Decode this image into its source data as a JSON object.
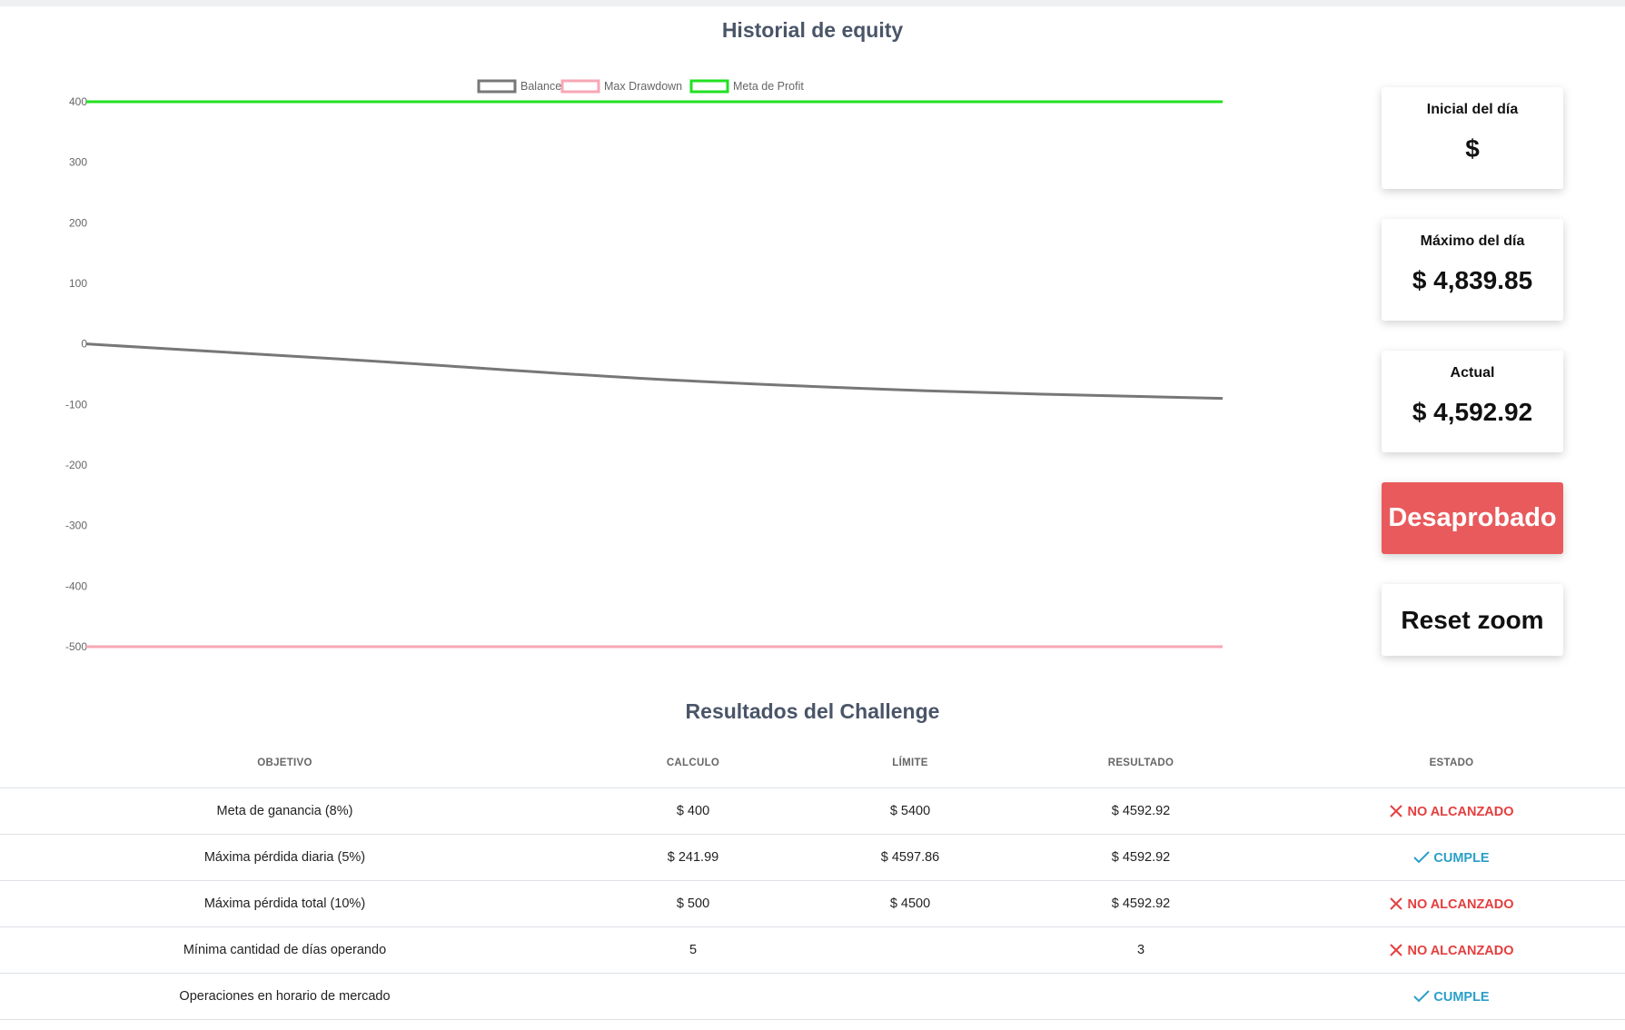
{
  "chart_title": "Historial de equity",
  "chart_data": {
    "type": "line",
    "legend": [
      "Balance",
      "Max Drawdown",
      "Meta de Profit"
    ],
    "legend_position": "top",
    "grid": false,
    "ylim": [
      -500,
      400
    ],
    "y_ticks": [
      "400",
      "300",
      "200",
      "100",
      "0",
      "-100",
      "-200",
      "-300",
      "-400",
      "-500"
    ],
    "series": [
      {
        "name": "Balance",
        "color": "#777777",
        "x": [
          0,
          1,
          2,
          3,
          4
        ],
        "values": [
          0,
          -28,
          -58,
          -78,
          -90
        ]
      },
      {
        "name": "Max Drawdown",
        "color": "#f7a7b4",
        "x": [
          0,
          4
        ],
        "values": [
          -500,
          -500
        ]
      },
      {
        "name": "Meta de Profit",
        "color": "#22e022",
        "x": [
          0,
          4
        ],
        "values": [
          400,
          400
        ]
      }
    ]
  },
  "cards": {
    "inicial": {
      "label": "Inicial del día",
      "value": "$"
    },
    "maximo": {
      "label": "Máximo del día",
      "value": "$ 4,839.85"
    },
    "actual": {
      "label": "Actual",
      "value": "$ 4,592.92"
    }
  },
  "status_label": "Desaprobado",
  "reset_label": "Reset zoom",
  "results": {
    "title": "Resultados del Challenge",
    "headers": [
      "OBJETIVO",
      "CALCULO",
      "LÍMITE",
      "RESULTADO",
      "ESTADO"
    ],
    "rows": [
      {
        "objetivo": "Meta de ganancia (8%)",
        "calculo": "$ 400",
        "limite": "$ 5400",
        "resultado": "$ 4592.92",
        "estado": "NO ALCANZADO"
      },
      {
        "objetivo": "Máxima pérdida diaria (5%)",
        "calculo": "$ 241.99",
        "limite": "$ 4597.86",
        "resultado": "$ 4592.92",
        "estado": "CUMPLE"
      },
      {
        "objetivo": "Máxima pérdida total (10%)",
        "calculo": "$ 500",
        "limite": "$ 4500",
        "resultado": "$ 4592.92",
        "estado": "NO ALCANZADO"
      },
      {
        "objetivo": "Mínima cantidad de días operando",
        "calculo": "5",
        "limite": "",
        "resultado": "3",
        "estado": "NO ALCANZADO"
      },
      {
        "objetivo": "Operaciones en horario de mercado",
        "calculo": "",
        "limite": "",
        "resultado": "",
        "estado": "CUMPLE"
      }
    ]
  }
}
